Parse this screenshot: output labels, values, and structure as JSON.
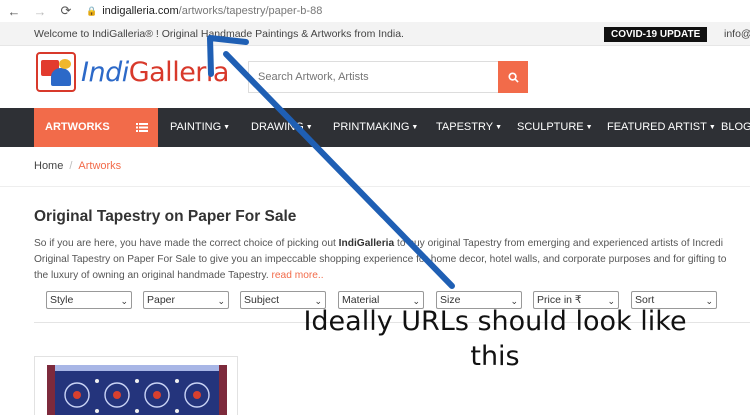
{
  "browser": {
    "url_host": "indigalleria.com",
    "url_path": "/artworks/tapestry/paper-b-88"
  },
  "topbar": {
    "welcome_text": "Welcome to IndiGalleria® ! Original Handmade Paintings & Artworks from India.",
    "covid_label": "COVID-19 UPDATE",
    "email_partial": "info@"
  },
  "header": {
    "logo_indi": "Indi",
    "logo_galleria": "Galleria",
    "search_placeholder": "Search Artwork, Artists"
  },
  "nav": {
    "artworks": "ARTWORKS",
    "items": [
      {
        "label": "PAINTING"
      },
      {
        "label": "DRAWING"
      },
      {
        "label": "PRINTMAKING"
      },
      {
        "label": "TAPESTRY"
      },
      {
        "label": "SCULPTURE"
      },
      {
        "label": "FEATURED ARTIST"
      },
      {
        "label": "BLOG"
      }
    ]
  },
  "breadcrumb": {
    "home": "Home",
    "sep": "/",
    "current": "Artworks"
  },
  "content": {
    "title": "Original Tapestry on Paper For Sale",
    "line1_a": "So if you are here, you have made the correct choice of picking out ",
    "line1_brand": "IndiGalleria",
    "line1_b": " to buy original Tapestry from emerging and experienced artists of Incredi",
    "line2": "Original Tapestry on Paper For Sale to give you an impeccable shopping experience for home decor, hotel walls, and corporate purposes and for gifting to",
    "line3": "the luxury of owning an original handmade Tapestry. ",
    "read_more": "read more.."
  },
  "filters": [
    {
      "label": "Style"
    },
    {
      "label": "Paper"
    },
    {
      "label": "Subject"
    },
    {
      "label": "Material"
    },
    {
      "label": "Size"
    },
    {
      "label": "Price in ₹"
    },
    {
      "label": "Sort"
    }
  ],
  "annotation": {
    "line1": "Ideally URLs should look like",
    "line2": "this",
    "arrow_color": "#1f5fb4"
  },
  "colors": {
    "accent": "#f26b4a",
    "nav_bg": "#2e3035"
  }
}
